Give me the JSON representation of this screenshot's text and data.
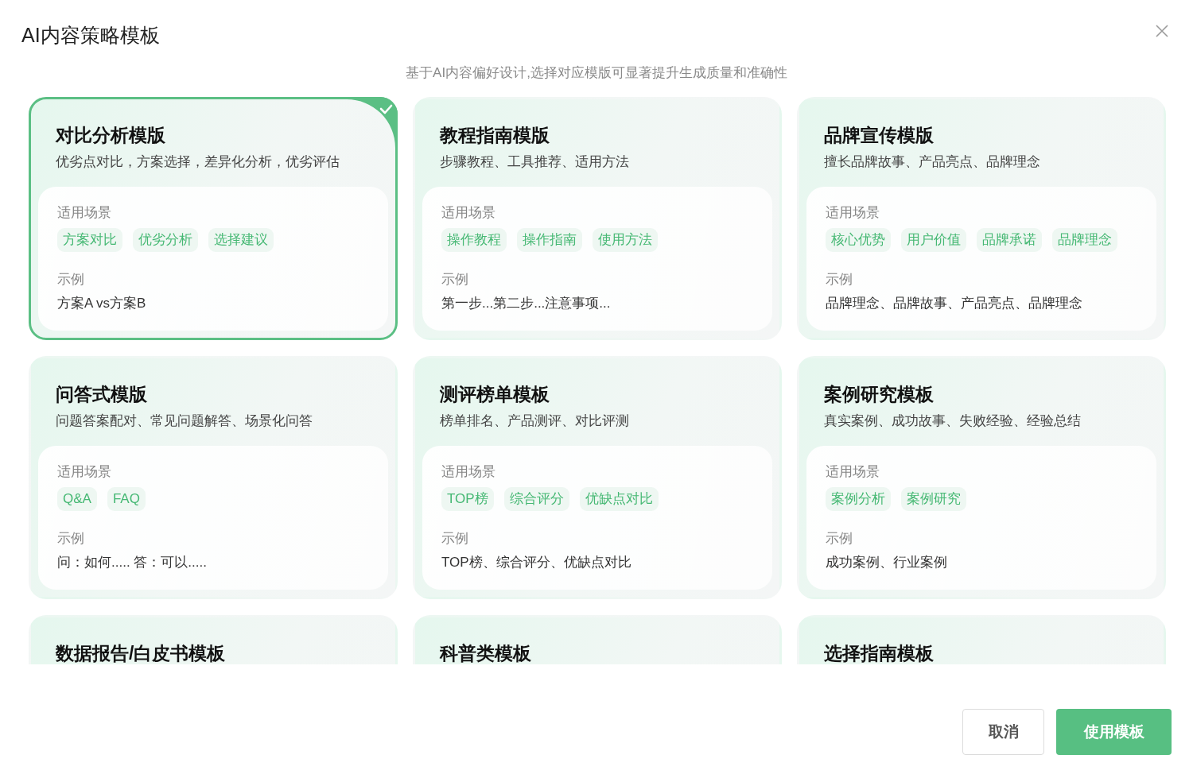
{
  "dialog": {
    "title": "AI内容策略模板",
    "subtitle": "基于AI内容偏好设计,选择对应模版可显著提升生成质量和准确性"
  },
  "cards": [
    {
      "title": "对比分析模版",
      "description": "优劣点对比，方案选择，差异化分析，优劣评估",
      "scenes_label": "适用场景",
      "tags": [
        "方案对比",
        "优劣分析",
        "选择建议"
      ],
      "example_label": "示例",
      "example": "方案A vs方案B",
      "selected": true
    },
    {
      "title": "教程指南模版",
      "description": "步骤教程、工具推荐、适用方法",
      "scenes_label": "适用场景",
      "tags": [
        "操作教程",
        "操作指南",
        "使用方法"
      ],
      "example_label": "示例",
      "example": "第一步...第二步...注意事项...",
      "selected": false
    },
    {
      "title": "品牌宣传模版",
      "description": "擅长品牌故事、产品亮点、品牌理念",
      "scenes_label": "适用场景",
      "tags": [
        "核心优势",
        "用户价值",
        "品牌承诺",
        "品牌理念"
      ],
      "example_label": "示例",
      "example": "品牌理念、品牌故事、产品亮点、品牌理念",
      "selected": false
    },
    {
      "title": "问答式模版",
      "description": "问题答案配对、常见问题解答、场景化问答",
      "scenes_label": "适用场景",
      "tags": [
        "Q&A",
        "FAQ"
      ],
      "example_label": "示例",
      "example": "问：如何..... 答：可以.....",
      "selected": false
    },
    {
      "title": "测评榜单模板",
      "description": "榜单排名、产品测评、对比评测",
      "scenes_label": "适用场景",
      "tags": [
        "TOP榜",
        "综合评分",
        "优缺点对比"
      ],
      "example_label": "示例",
      "example": "TOP榜、综合评分、优缺点对比",
      "selected": false
    },
    {
      "title": "案例研究模板",
      "description": "真实案例、成功故事、失败经验、经验总结",
      "scenes_label": "适用场景",
      "tags": [
        "案例分析",
        "案例研究"
      ],
      "example_label": "示例",
      "example": "成功案例、行业案例",
      "selected": false
    },
    {
      "title": "数据报告/白皮书模板",
      "selected": false
    },
    {
      "title": "科普类模板",
      "selected": false
    },
    {
      "title": "选择指南模板",
      "selected": false
    }
  ],
  "buttons": [
    {
      "label": "取消",
      "kind": "secondary"
    },
    {
      "label": "使用模板",
      "kind": "primary"
    }
  ]
}
